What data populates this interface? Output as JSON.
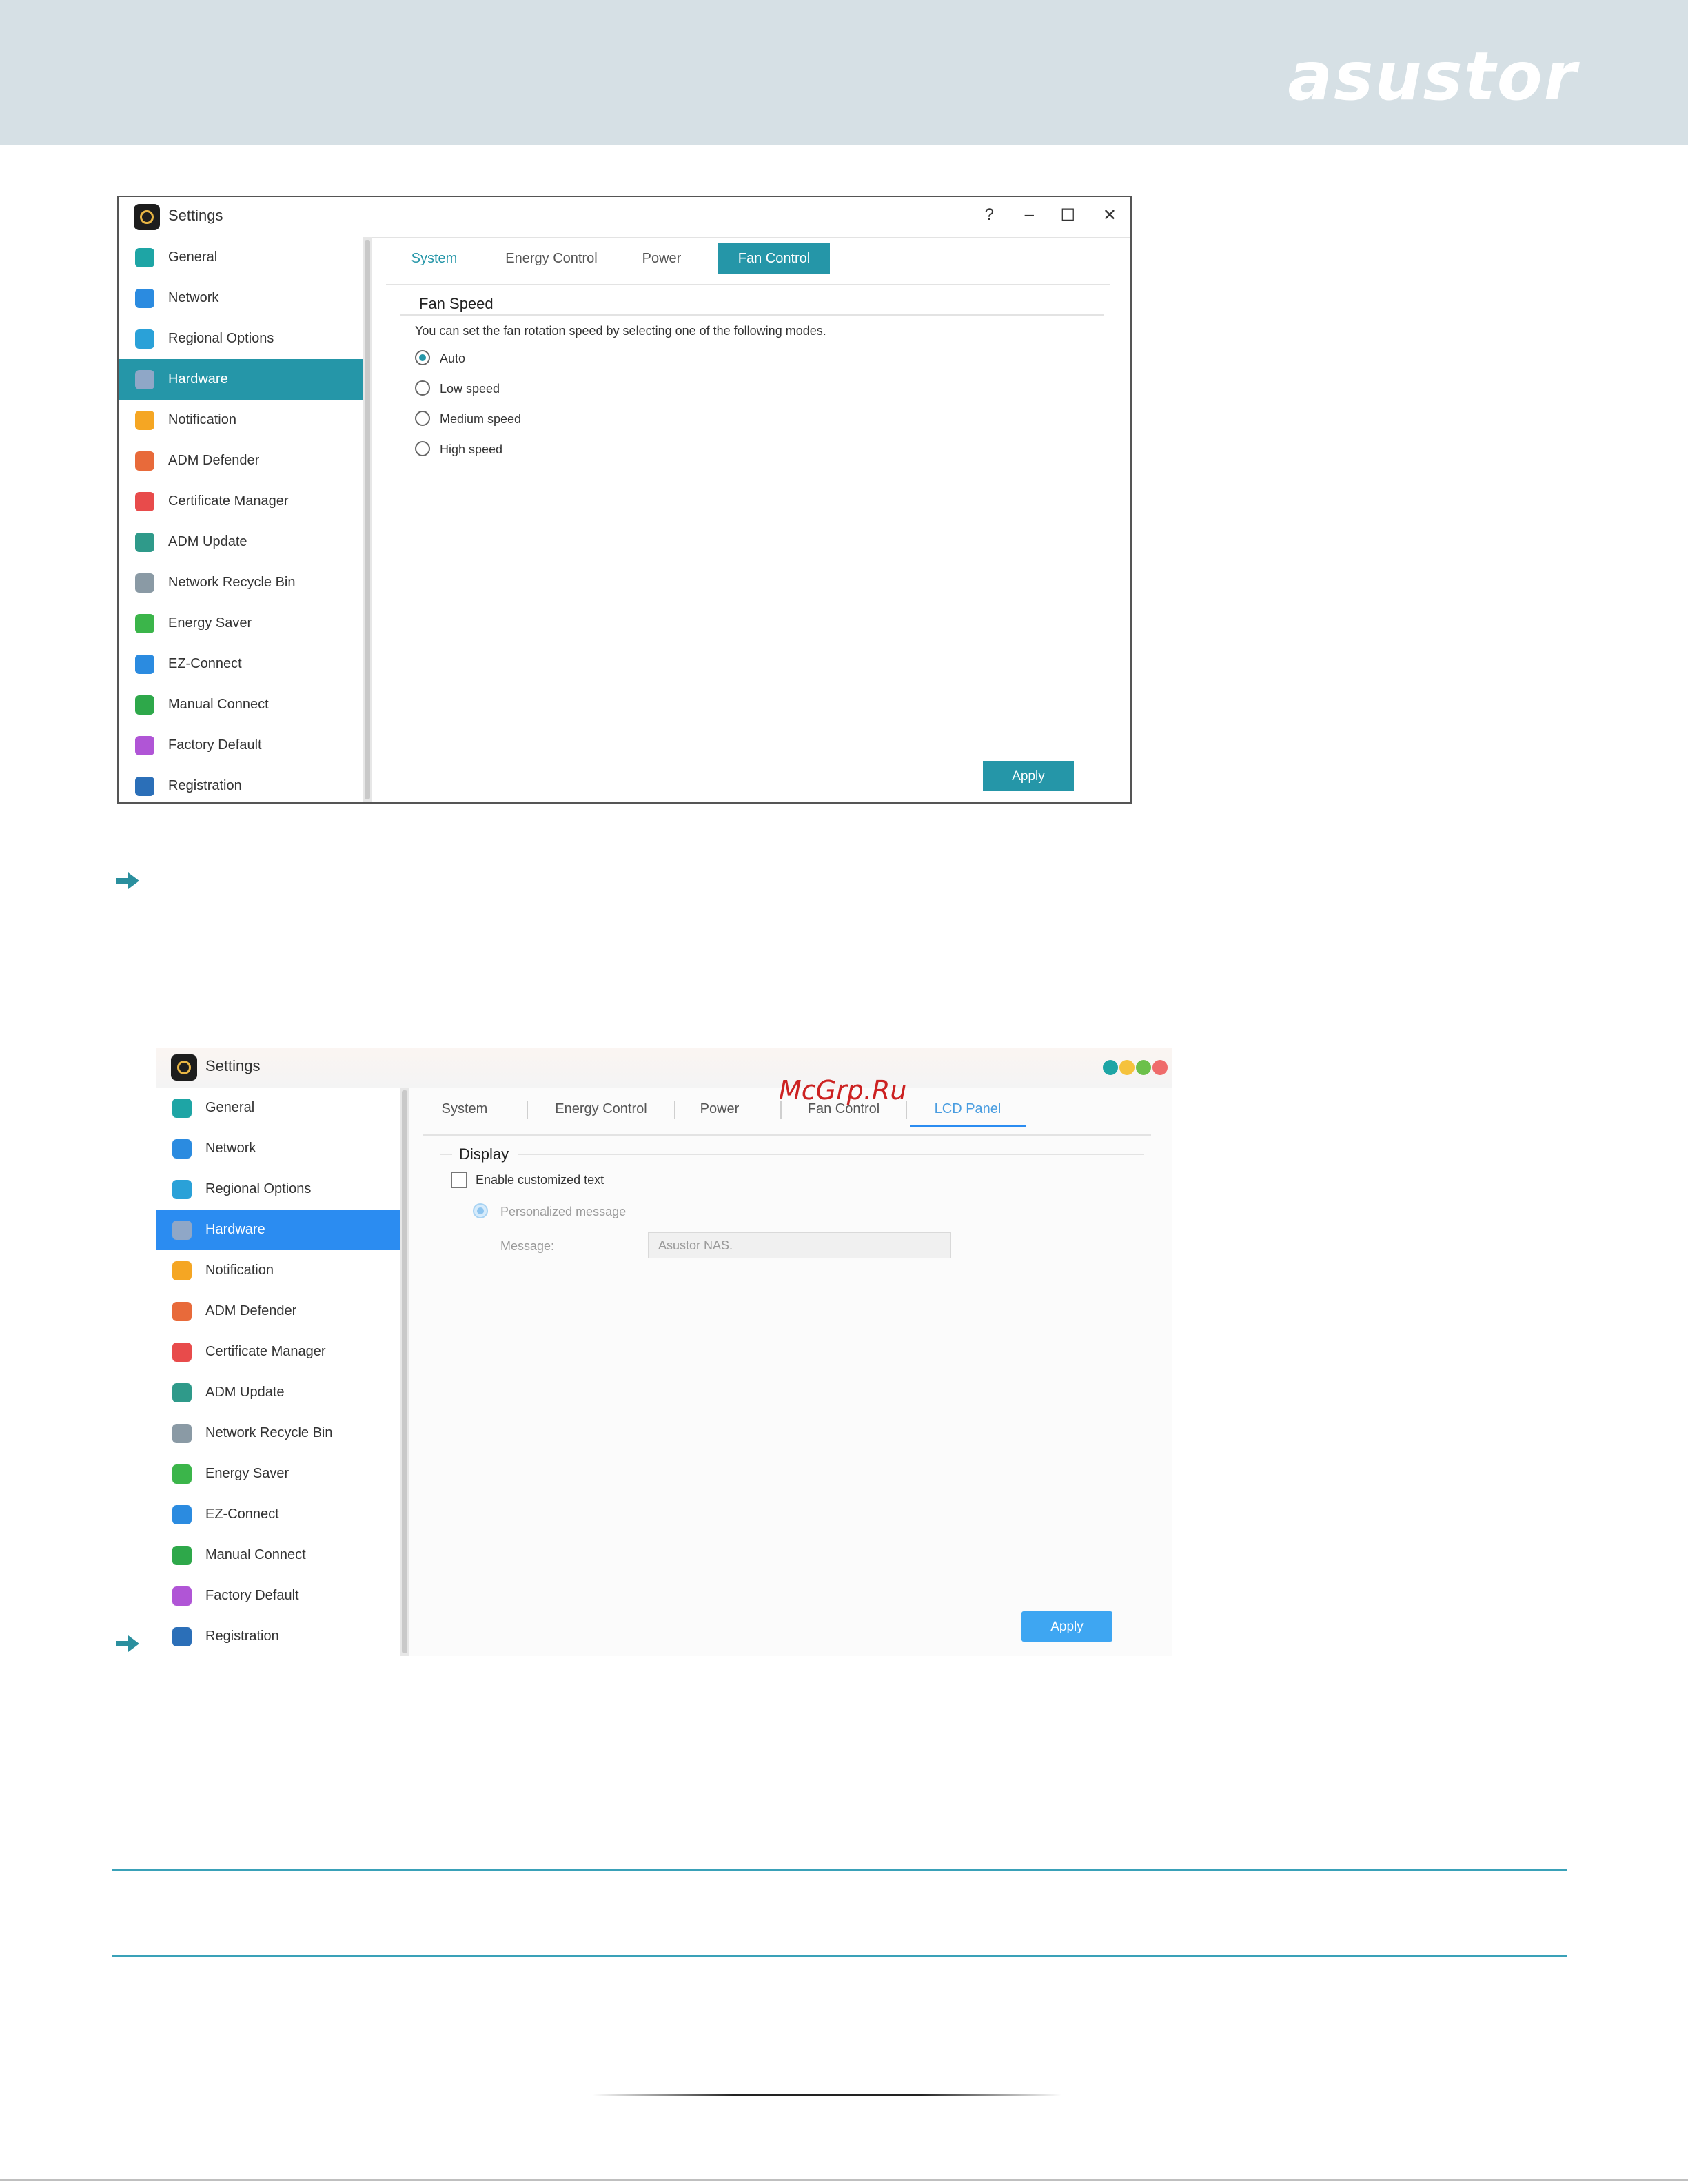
{
  "brand": {
    "logo_text": "asustor"
  },
  "window1": {
    "title": "Settings",
    "controls": {
      "help": "?",
      "minimize": "–",
      "maximize": "☐",
      "close": "✕"
    },
    "sidebar": [
      {
        "label": "General",
        "icon": "general-icon",
        "color": "#1ea5a5"
      },
      {
        "label": "Network",
        "icon": "globe-icon",
        "color": "#2b8be0"
      },
      {
        "label": "Regional Options",
        "icon": "regional-options-icon",
        "color": "#2aa1d8"
      },
      {
        "label": "Hardware",
        "icon": "hardware-icon",
        "color": "#8fa7c7"
      },
      {
        "label": "Notification",
        "icon": "notification-icon",
        "color": "#f5a623"
      },
      {
        "label": "ADM Defender",
        "icon": "firewall-icon",
        "color": "#e86a3a"
      },
      {
        "label": "Certificate Manager",
        "icon": "certificate-icon",
        "color": "#e84b4b"
      },
      {
        "label": "ADM Update",
        "icon": "update-icon",
        "color": "#2f9a8a"
      },
      {
        "label": "Network Recycle Bin",
        "icon": "recycle-bin-icon",
        "color": "#8a9aa5"
      },
      {
        "label": "Energy Saver",
        "icon": "energy-saver-icon",
        "color": "#3bb54a"
      },
      {
        "label": "EZ-Connect",
        "icon": "cloud-icon",
        "color": "#2b8be0"
      },
      {
        "label": "Manual Connect",
        "icon": "manual-connect-icon",
        "color": "#2ea84a"
      },
      {
        "label": "Factory Default",
        "icon": "factory-default-icon",
        "color": "#b055d6"
      },
      {
        "label": "Registration",
        "icon": "registration-icon",
        "color": "#2b6fb8"
      }
    ],
    "active_item": "Hardware",
    "tabs": [
      "System",
      "Energy Control",
      "Power",
      "Fan Control"
    ],
    "active_tab": "Fan Control",
    "section_title": "Fan Speed",
    "description": "You can set the fan rotation speed by selecting one of the following modes.",
    "options": [
      "Auto",
      "Low speed",
      "Medium speed",
      "High speed"
    ],
    "selected_option": "Auto",
    "apply_label": "Apply"
  },
  "window2": {
    "title": "Settings",
    "traffic_lights": [
      "#1ea5a5",
      "#f5c23d",
      "#6cc04a",
      "#ef6b6b"
    ],
    "sidebar": [
      {
        "label": "General",
        "icon": "general-icon",
        "color": "#1ea5a5"
      },
      {
        "label": "Network",
        "icon": "globe-icon",
        "color": "#2b8be0"
      },
      {
        "label": "Regional Options",
        "icon": "regional-options-icon",
        "color": "#2aa1d8"
      },
      {
        "label": "Hardware",
        "icon": "hardware-icon",
        "color": "#8fa7c7"
      },
      {
        "label": "Notification",
        "icon": "notification-icon",
        "color": "#f5a623"
      },
      {
        "label": "ADM Defender",
        "icon": "firewall-icon",
        "color": "#e86a3a"
      },
      {
        "label": "Certificate Manager",
        "icon": "certificate-icon",
        "color": "#e84b4b"
      },
      {
        "label": "ADM Update",
        "icon": "update-icon",
        "color": "#2f9a8a"
      },
      {
        "label": "Network Recycle Bin",
        "icon": "recycle-bin-icon",
        "color": "#8a9aa5"
      },
      {
        "label": "Energy Saver",
        "icon": "energy-saver-icon",
        "color": "#3bb54a"
      },
      {
        "label": "EZ-Connect",
        "icon": "cloud-icon",
        "color": "#2b8be0"
      },
      {
        "label": "Manual Connect",
        "icon": "manual-connect-icon",
        "color": "#2ea84a"
      },
      {
        "label": "Factory Default",
        "icon": "factory-default-icon",
        "color": "#b055d6"
      },
      {
        "label": "Registration",
        "icon": "registration-icon",
        "color": "#2b6fb8"
      }
    ],
    "active_item": "Hardware",
    "tabs": [
      "System",
      "Energy Control",
      "Power",
      "Fan Control",
      "LCD Panel"
    ],
    "active_tab": "LCD Panel",
    "section_title": "Display",
    "checkbox_label": "Enable customized text",
    "radio_label": "Personalized message",
    "message_label": "Message:",
    "message_value": "Asustor NAS.",
    "apply_label": "Apply"
  },
  "watermark": "McGrp.Ru",
  "colors": {
    "teal_accent": "#2596a8",
    "blue_accent": "#2b8cf1",
    "header_band": "#d6e0e5",
    "arrow": "#2a8f9e"
  }
}
